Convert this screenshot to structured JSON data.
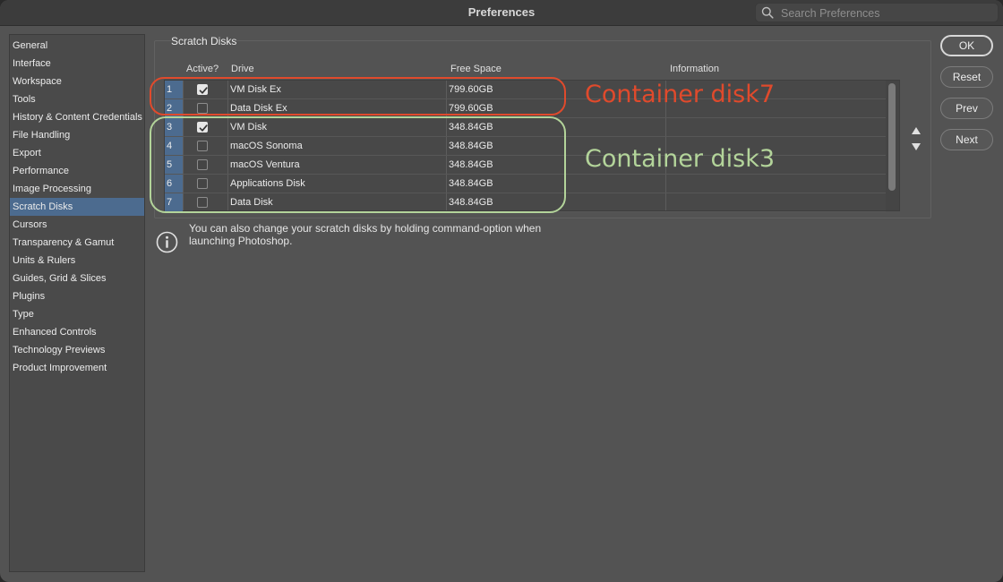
{
  "window": {
    "title": "Preferences"
  },
  "search": {
    "placeholder": "Search Preferences",
    "value": ""
  },
  "sidebar": {
    "items": [
      {
        "label": "General"
      },
      {
        "label": "Interface"
      },
      {
        "label": "Workspace"
      },
      {
        "label": "Tools"
      },
      {
        "label": "History & Content Credentials"
      },
      {
        "label": "File Handling"
      },
      {
        "label": "Export"
      },
      {
        "label": "Performance"
      },
      {
        "label": "Image Processing"
      },
      {
        "label": "Scratch Disks",
        "selected": true
      },
      {
        "label": "Cursors"
      },
      {
        "label": "Transparency & Gamut"
      },
      {
        "label": "Units & Rulers"
      },
      {
        "label": "Guides, Grid & Slices"
      },
      {
        "label": "Plugins"
      },
      {
        "label": "Type"
      },
      {
        "label": "Enhanced Controls"
      },
      {
        "label": "Technology Previews"
      },
      {
        "label": "Product Improvement"
      }
    ]
  },
  "scratch_disks": {
    "section_title": "Scratch Disks",
    "columns": {
      "active": "Active?",
      "drive": "Drive",
      "free_space": "Free Space",
      "information": "Information"
    },
    "rows": [
      {
        "num": "1",
        "active": true,
        "drive": "VM Disk Ex",
        "free_space": "799.60GB",
        "information": ""
      },
      {
        "num": "2",
        "active": false,
        "drive": "Data Disk Ex",
        "free_space": "799.60GB",
        "information": ""
      },
      {
        "num": "3",
        "active": true,
        "drive": "VM Disk",
        "free_space": "348.84GB",
        "information": ""
      },
      {
        "num": "4",
        "active": false,
        "drive": "macOS Sonoma",
        "free_space": "348.84GB",
        "information": ""
      },
      {
        "num": "5",
        "active": false,
        "drive": "macOS Ventura",
        "free_space": "348.84GB",
        "information": ""
      },
      {
        "num": "6",
        "active": false,
        "drive": "Applications Disk",
        "free_space": "348.84GB",
        "information": ""
      },
      {
        "num": "7",
        "active": false,
        "drive": "Data Disk",
        "free_space": "348.84GB",
        "information": ""
      }
    ],
    "move_up_icon": "triangle-up-icon",
    "move_down_icon": "triangle-down-icon"
  },
  "info_note": "You can also change your scratch disks by holding command-option when launching Photoshop.",
  "buttons": {
    "ok": "OK",
    "reset": "Reset",
    "prev": "Prev",
    "next": "Next"
  },
  "annotations": {
    "red_label": "Container disk7",
    "green_label": "Container disk3",
    "red_color": "#e04a2c",
    "green_color": "#b3d49a"
  },
  "colors": {
    "window_bg": "#535353",
    "selection": "#4c6b8f"
  }
}
